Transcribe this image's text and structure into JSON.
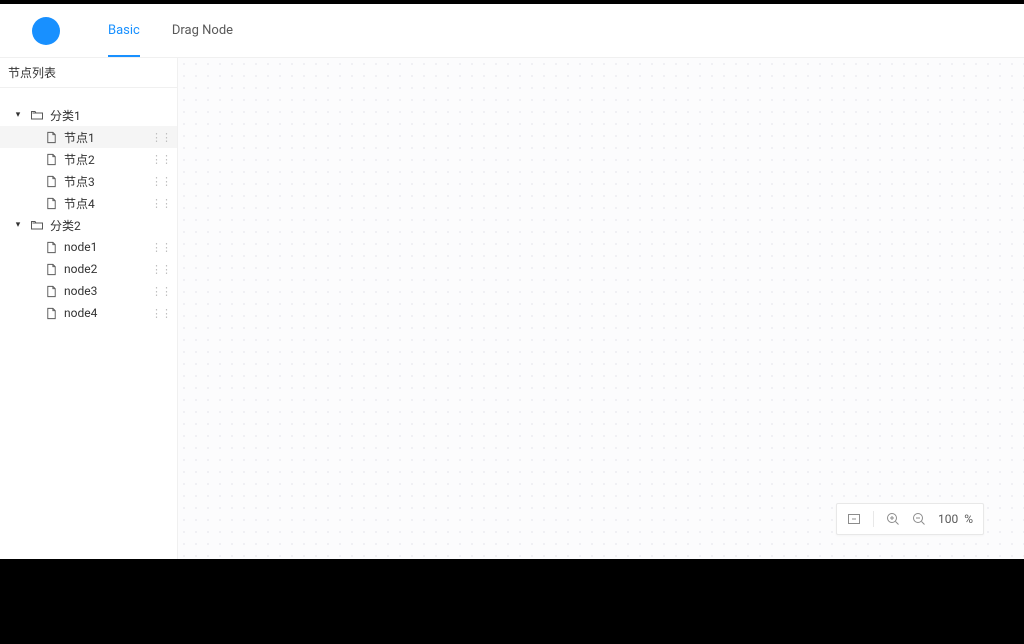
{
  "header": {
    "tabs": [
      {
        "label": "Basic",
        "active": true
      },
      {
        "label": "Drag Node",
        "active": false
      }
    ]
  },
  "sidebar": {
    "title": "节点列表",
    "groups": [
      {
        "label": "分类1",
        "expanded": true,
        "items": [
          {
            "label": "节点1",
            "hovered": true
          },
          {
            "label": "节点2",
            "hovered": false
          },
          {
            "label": "节点3",
            "hovered": false
          },
          {
            "label": "节点4",
            "hovered": false
          }
        ]
      },
      {
        "label": "分类2",
        "expanded": true,
        "items": [
          {
            "label": "node1",
            "hovered": false
          },
          {
            "label": "node2",
            "hovered": false
          },
          {
            "label": "node3",
            "hovered": false
          },
          {
            "label": "node4",
            "hovered": false
          }
        ]
      }
    ]
  },
  "zoom": {
    "value": "100",
    "unit": "%"
  }
}
